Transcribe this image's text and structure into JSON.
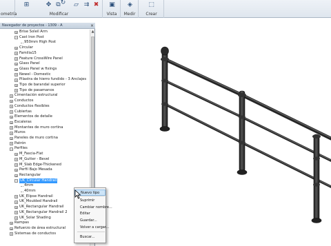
{
  "ribbon": {
    "groups": [
      {
        "label": "ometría"
      },
      {
        "label": "Modificar"
      },
      {
        "label": "Vista"
      },
      {
        "label": "Medir"
      },
      {
        "label": "Crear"
      }
    ]
  },
  "browser": {
    "title": "Navegador de proyectos - 1309 - A",
    "close": "×",
    "tree": [
      {
        "text": "Brise Soleil Arm",
        "toggle": "+",
        "indent": 1
      },
      {
        "text": "Cast Iron Post",
        "toggle": "−",
        "indent": 1
      },
      {
        "text": "950mm High Post",
        "toggle": "",
        "indent": 2
      },
      {
        "text": "Circular",
        "toggle": "+",
        "indent": 1
      },
      {
        "text": "Familia15",
        "toggle": "+",
        "indent": 1
      },
      {
        "text": "Feature CrossWire Panel",
        "toggle": "+",
        "indent": 1
      },
      {
        "text": "Glass Panel",
        "toggle": "+",
        "indent": 1
      },
      {
        "text": "Glass Panel w fixings",
        "toggle": "+",
        "indent": 1
      },
      {
        "text": "Newel - Domestic",
        "toggle": "+",
        "indent": 1
      },
      {
        "text": "Pilastra de hierro fundido - 3 Anclajes",
        "toggle": "+",
        "indent": 1
      },
      {
        "text": "Tipo de barandal superior",
        "toggle": "+",
        "indent": 1
      },
      {
        "text": "Tipo de pasamanos",
        "toggle": "+",
        "indent": 1
      },
      {
        "text": "Cimentación estructural",
        "toggle": "+",
        "indent": 0
      },
      {
        "text": "Conductos",
        "toggle": "+",
        "indent": 0
      },
      {
        "text": "Conductos flexibles",
        "toggle": "+",
        "indent": 0
      },
      {
        "text": "Cubiertas",
        "toggle": "+",
        "indent": 0
      },
      {
        "text": "Elementos de detalle",
        "toggle": "+",
        "indent": 0
      },
      {
        "text": "Escaleras",
        "toggle": "+",
        "indent": 0
      },
      {
        "text": "Montantes de muro cortina",
        "toggle": "+",
        "indent": 0
      },
      {
        "text": "Muros",
        "toggle": "+",
        "indent": 0
      },
      {
        "text": "Paneles de muro cortina",
        "toggle": "+",
        "indent": 0
      },
      {
        "text": "Patrón",
        "toggle": "+",
        "indent": 0
      },
      {
        "text": "Perfiles",
        "toggle": "−",
        "indent": 0
      },
      {
        "text": "M_Fascia-Flat",
        "toggle": "+",
        "indent": 1
      },
      {
        "text": "M_Gutter - Bevel",
        "toggle": "+",
        "indent": 1
      },
      {
        "text": "M_Slab Edge-Thickened",
        "toggle": "+",
        "indent": 1
      },
      {
        "text": "Perfil Bajo Mesada",
        "toggle": "+",
        "indent": 1
      },
      {
        "text": "Rectangular",
        "toggle": "+",
        "indent": 1
      },
      {
        "text": "UK_Circular Handrail",
        "toggle": "−",
        "indent": 1,
        "selected": true
      },
      {
        "text": "4mm",
        "toggle": "",
        "indent": 2
      },
      {
        "text": "40mm",
        "toggle": "",
        "indent": 2
      },
      {
        "text": "UK_Elipse Handrail",
        "toggle": "+",
        "indent": 1
      },
      {
        "text": "UK_Moulded Handrail",
        "toggle": "+",
        "indent": 1
      },
      {
        "text": "UK_Rectangular Handrail",
        "toggle": "+",
        "indent": 1
      },
      {
        "text": "UK_Rectangular Handrail 2",
        "toggle": "+",
        "indent": 1
      },
      {
        "text": "UK_Solar Shading",
        "toggle": "+",
        "indent": 1
      },
      {
        "text": "Rampas",
        "toggle": "+",
        "indent": 0
      },
      {
        "text": "Refuerzo de área estructural",
        "toggle": "+",
        "indent": 0
      },
      {
        "text": "Sistemas de conductos",
        "toggle": "+",
        "indent": 0
      }
    ]
  },
  "context_menu": {
    "items": [
      "Nuevo tipo",
      "Suprimir",
      "Cambiar nombre...",
      "Editar",
      "Guardar...",
      "Volver a cargar...",
      "Buscar..."
    ],
    "highlighted_index": 0
  },
  "colors": {
    "selection": "#3399ff",
    "rail": "#2b2b2b",
    "menu_highlight": "#cde4f7"
  }
}
